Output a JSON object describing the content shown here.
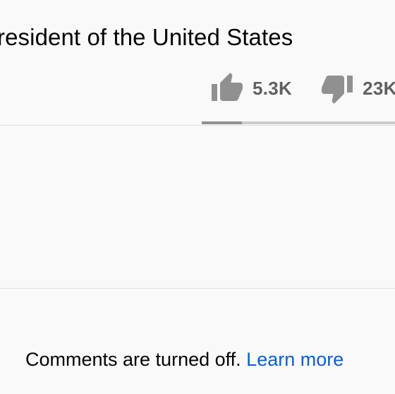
{
  "video": {
    "title": "resident of the United States"
  },
  "actions": {
    "like": {
      "icon": "thumb-up-icon",
      "count": "5.3K"
    },
    "dislike": {
      "icon": "thumb-down-icon",
      "count": "23K"
    }
  },
  "sentiment": {
    "like_fraction": 0.19,
    "fill_color": "#909090",
    "track_color": "#cccccc"
  },
  "comments": {
    "message": "Comments are turned off.",
    "link_label": "Learn more",
    "link_color": "#065fd4"
  }
}
